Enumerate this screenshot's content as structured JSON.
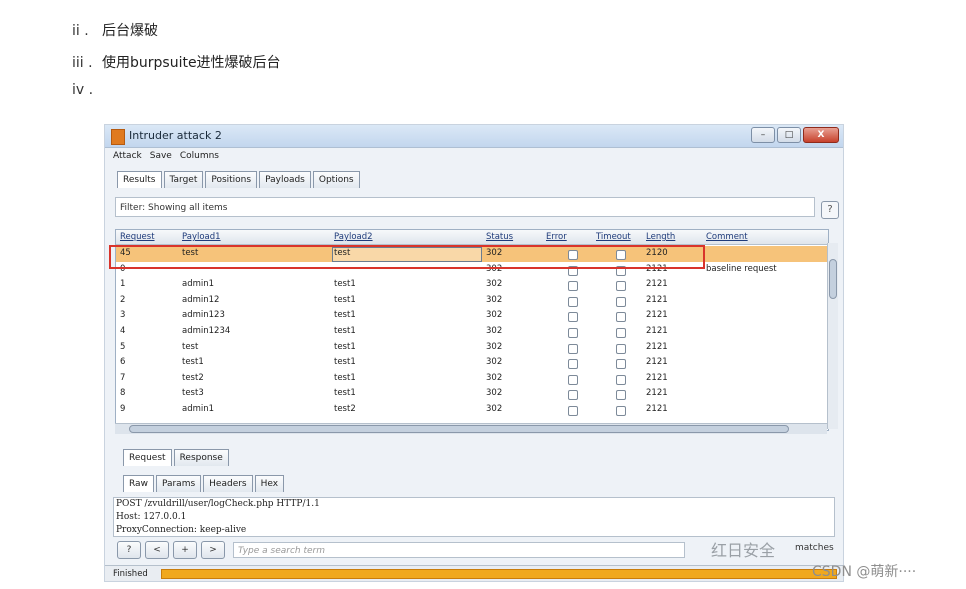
{
  "article": {
    "items": [
      {
        "marker": "ii .",
        "text": "后台爆破"
      },
      {
        "marker": "iii .",
        "text": "使用burpsuite进性爆破后台"
      },
      {
        "marker": "iv .",
        "text": ""
      }
    ]
  },
  "window": {
    "title": "Intruder attack 2",
    "controls": [
      "–",
      "□",
      "X"
    ]
  },
  "menu": [
    "Attack",
    "Save",
    "Columns"
  ],
  "tabs": [
    "Results",
    "Target",
    "Positions",
    "Payloads",
    "Options"
  ],
  "active_tab": "Results",
  "filter": {
    "text": "Filter: Showing all items",
    "help": "?"
  },
  "table": {
    "columns": [
      "Request",
      "Payload1",
      "Payload2",
      "Status",
      "Error",
      "Timeout",
      "Length",
      "Comment"
    ],
    "rows": [
      {
        "request": "45",
        "payload1": "test",
        "payload2": "test",
        "status": "302",
        "length": "2120",
        "comment": ""
      },
      {
        "request": "0",
        "payload1": "",
        "payload2": "",
        "status": "302",
        "length": "2121",
        "comment": "baseline request"
      },
      {
        "request": "1",
        "payload1": "admin1",
        "payload2": "test1",
        "status": "302",
        "length": "2121",
        "comment": ""
      },
      {
        "request": "2",
        "payload1": "admin12",
        "payload2": "test1",
        "status": "302",
        "length": "2121",
        "comment": ""
      },
      {
        "request": "3",
        "payload1": "admin123",
        "payload2": "test1",
        "status": "302",
        "length": "2121",
        "comment": ""
      },
      {
        "request": "4",
        "payload1": "admin1234",
        "payload2": "test1",
        "status": "302",
        "length": "2121",
        "comment": ""
      },
      {
        "request": "5",
        "payload1": "test",
        "payload2": "test1",
        "status": "302",
        "length": "2121",
        "comment": ""
      },
      {
        "request": "6",
        "payload1": "test1",
        "payload2": "test1",
        "status": "302",
        "length": "2121",
        "comment": ""
      },
      {
        "request": "7",
        "payload1": "test2",
        "payload2": "test1",
        "status": "302",
        "length": "2121",
        "comment": ""
      },
      {
        "request": "8",
        "payload1": "test3",
        "payload2": "test1",
        "status": "302",
        "length": "2121",
        "comment": ""
      },
      {
        "request": "9",
        "payload1": "admin1",
        "payload2": "test2",
        "status": "302",
        "length": "2121",
        "comment": ""
      }
    ]
  },
  "response_tabs": [
    "Request",
    "Response"
  ],
  "sub_tabs": [
    "Raw",
    "Params",
    "Headers",
    "Hex"
  ],
  "request_text": [
    "POST /zvuldrill/user/logCheck.php HTTP/1.1",
    "Host: 127.0.0.1",
    "ProxyConnection: keep-alive"
  ],
  "search": {
    "buttons": [
      "?",
      "<",
      "+",
      ">"
    ],
    "placeholder": "Type a search term",
    "matches_label": "matches"
  },
  "wechat_watermark": "红日安全",
  "status": {
    "text": "Finished",
    "progress": 1.0
  },
  "csdn_watermark": "CSDN @萌新····",
  "colors": {
    "highlight": "#f6c37a",
    "annotation": "#d9342b",
    "progress": "#f0a81e"
  }
}
